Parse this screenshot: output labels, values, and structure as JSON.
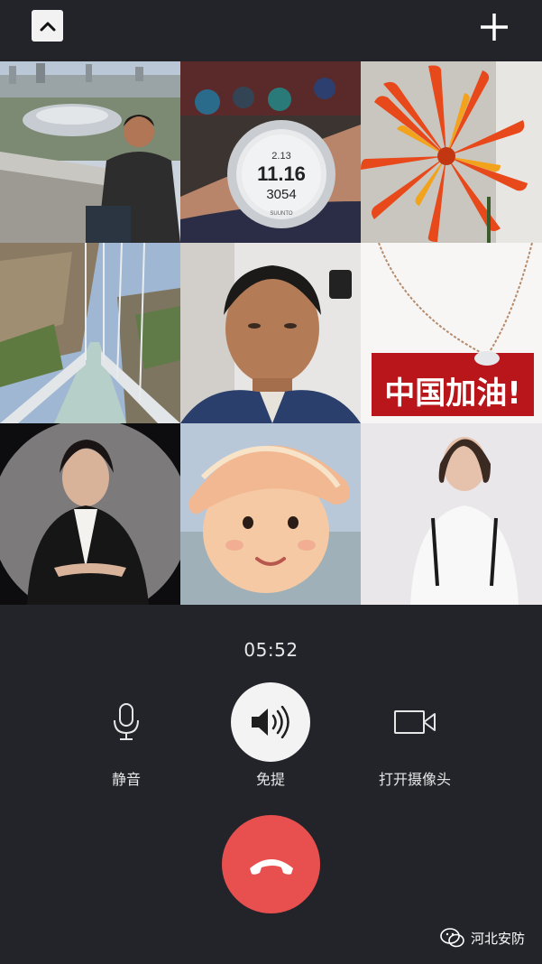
{
  "header": {
    "collapse_icon": "chevron-up-icon",
    "add_icon": "plus-icon"
  },
  "participants": [
    {
      "id": "p1",
      "description_icon": "participant-video"
    },
    {
      "id": "p2",
      "description_icon": "participant-video"
    },
    {
      "id": "p3",
      "description_icon": "participant-video"
    },
    {
      "id": "p4",
      "description_icon": "participant-video"
    },
    {
      "id": "p5",
      "description_icon": "participant-video"
    },
    {
      "id": "p6",
      "description_icon": "participant-video"
    },
    {
      "id": "p7",
      "description_icon": "participant-video"
    },
    {
      "id": "p8",
      "description_icon": "participant-video"
    },
    {
      "id": "p9",
      "description_icon": "participant-video"
    }
  ],
  "watch": {
    "time": "11.16",
    "altitude": "3054"
  },
  "banner": {
    "text": "中国加油!"
  },
  "call": {
    "duration": "05:52"
  },
  "controls": {
    "mute_label": "静音",
    "speaker_label": "免提",
    "camera_label": "打开摄像头"
  },
  "watermark": {
    "text": "河北安防"
  },
  "colors": {
    "background": "#23242a",
    "hangup": "#e8504f",
    "speaker_active": "#f3f3f3"
  }
}
